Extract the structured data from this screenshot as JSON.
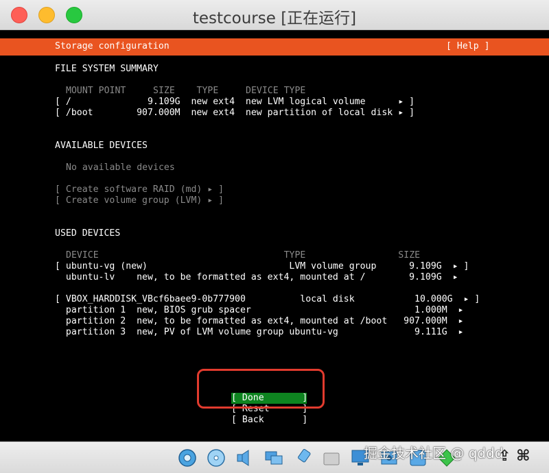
{
  "window": {
    "title": "testcourse [正在运行]"
  },
  "header": {
    "title": "Storage configuration",
    "help": "[ Help ]"
  },
  "fs_summary": {
    "heading": "FILE SYSTEM SUMMARY",
    "columns": "MOUNT POINT     SIZE    TYPE     DEVICE TYPE",
    "rows": [
      "[ /              9.109G  new ext4  new LVM logical volume      ▸ ]",
      "[ /boot        907.000M  new ext4  new partition of local disk ▸ ]"
    ]
  },
  "available": {
    "heading": "AVAILABLE DEVICES",
    "empty": "No available devices",
    "raid": "[ Create software RAID (md) ▸ ]",
    "vg": "[ Create volume group (LVM) ▸ ]"
  },
  "used": {
    "heading": "USED DEVICES",
    "columns": "DEVICE                                  TYPE                 SIZE",
    "rows": [
      "[ ubuntu-vg (new)                          LVM volume group      9.109G  ▸ ]",
      "  ubuntu-lv    new, to be formatted as ext4, mounted at /        9.109G  ▸",
      "[ VBOX_HARDDISK_VBcf6baee9-0b777900          local disk           10.000G  ▸ ]",
      "  partition 1  new, BIOS grub spacer                              1.000M  ▸",
      "  partition 2  new, to be formatted as ext4, mounted at /boot   907.000M  ▸",
      "  partition 3  new, PV of LVM volume group ubuntu-vg              9.111G  ▸"
    ]
  },
  "buttons": {
    "done": "[ Done       ]",
    "reset": "[ Reset      ]",
    "back": "[ Back       ]"
  },
  "watermark": "掘金技术社区 @ qddd",
  "host_key": "⇪ ⌘",
  "colors": {
    "header_bg": "#e95420",
    "selected_bg": "#0e8420",
    "annotation": "#e23b2e"
  },
  "statusbar_icons": [
    "hard-disk-icon",
    "optical-disk-icon",
    "audio-icon",
    "network-icon",
    "usb-icon",
    "shared-folder-icon",
    "display-icon",
    "recording-icon",
    "capture-icon",
    "mouse-integration-icon"
  ]
}
